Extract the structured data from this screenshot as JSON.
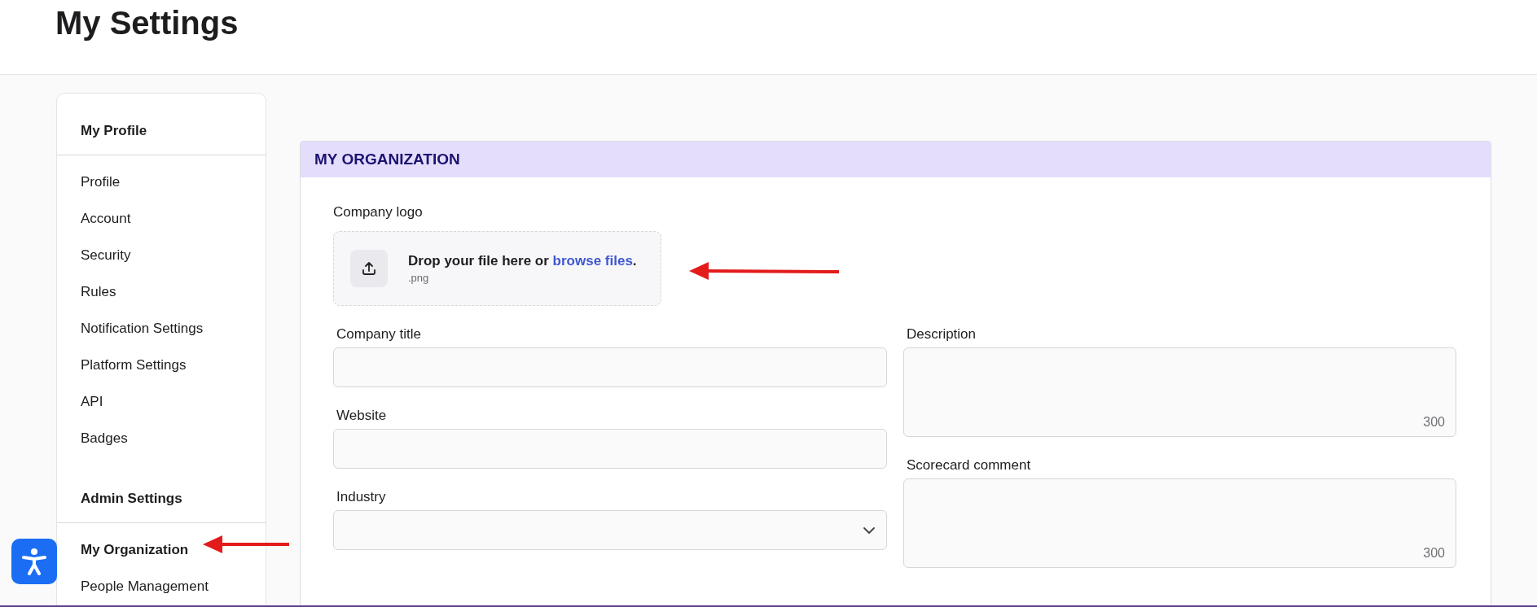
{
  "page": {
    "title": "My Settings"
  },
  "sidebar": {
    "sections": [
      {
        "heading": "My Profile",
        "items": [
          {
            "label": "Profile",
            "selected": false
          },
          {
            "label": "Account",
            "selected": false
          },
          {
            "label": "Security",
            "selected": false
          },
          {
            "label": "Rules",
            "selected": false
          },
          {
            "label": "Notification Settings",
            "selected": false
          },
          {
            "label": "Platform Settings",
            "selected": false
          },
          {
            "label": "API",
            "selected": false
          },
          {
            "label": "Badges",
            "selected": false
          }
        ]
      },
      {
        "heading": "Admin Settings",
        "items": [
          {
            "label": "My Organization",
            "selected": true
          },
          {
            "label": "People Management",
            "selected": false
          }
        ]
      }
    ]
  },
  "panel": {
    "title": "MY ORGANIZATION",
    "logo_upload": {
      "label": "Company logo",
      "prompt": "Drop your file here or ",
      "link": "browse files",
      "suffix": ".",
      "hint": ".png"
    },
    "left_fields": [
      {
        "kind": "text",
        "label": "Company title"
      },
      {
        "kind": "text",
        "label": "Website"
      },
      {
        "kind": "select",
        "label": "Industry"
      }
    ],
    "right_fields": [
      {
        "kind": "textarea",
        "label": "Description",
        "counter": "300"
      },
      {
        "kind": "textarea",
        "label": "Scorecard comment",
        "counter": "300"
      }
    ]
  }
}
